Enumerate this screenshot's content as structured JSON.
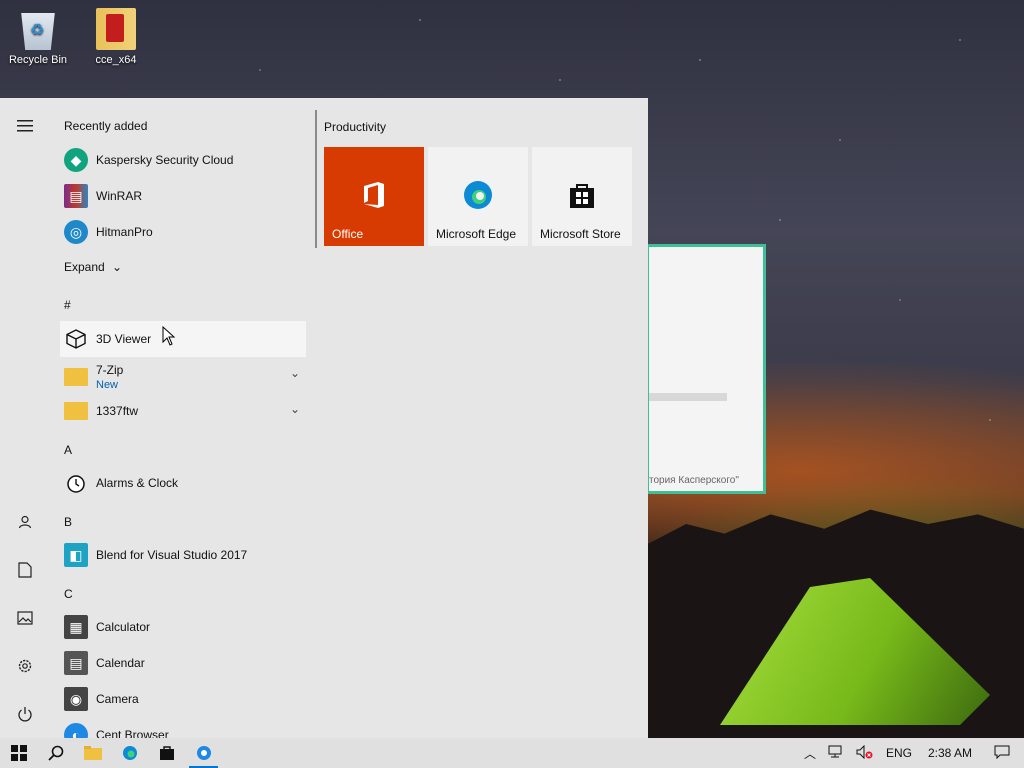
{
  "desktop": {
    "icons": [
      {
        "label": "Recycle Bin"
      },
      {
        "label": "cce_x64"
      }
    ],
    "background_window": {
      "text": "тория Касперского\""
    }
  },
  "start_menu": {
    "recently_added_label": "Recently added",
    "recent_apps": [
      {
        "name": "Kaspersky Security Cloud",
        "icon": "kaspersky-icon",
        "color": "#10a37f"
      },
      {
        "name": "WinRAR",
        "icon": "winrar-icon",
        "color": "#7b2c8c"
      },
      {
        "name": "HitmanPro",
        "icon": "hitmanpro-icon",
        "color": "#1e88c9"
      }
    ],
    "expand_label": "Expand",
    "sections": {
      "hash": "#",
      "a": "A",
      "b": "B",
      "c": "C"
    },
    "apps": {
      "viewer3d": {
        "name": "3D Viewer"
      },
      "zip7": {
        "name": "7-Zip",
        "sub": "New"
      },
      "ftw": {
        "name": "1337ftw"
      },
      "alarms": {
        "name": "Alarms & Clock"
      },
      "blend": {
        "name": "Blend for Visual Studio 2017"
      },
      "calculator": {
        "name": "Calculator"
      },
      "calendar": {
        "name": "Calendar"
      },
      "camera": {
        "name": "Camera"
      },
      "cent": {
        "name": "Cent Browser"
      }
    },
    "group_title": "Productivity",
    "tiles": [
      {
        "label": "Office",
        "bg": "#d83b01",
        "fg": "#ffffff"
      },
      {
        "label": "Microsoft Edge",
        "bg": "#f2f2f2",
        "fg": "#111111"
      },
      {
        "label": "Microsoft Store",
        "bg": "#f2f2f2",
        "fg": "#111111"
      }
    ]
  },
  "taskbar": {
    "language": "ENG",
    "time": "2:38 AM"
  }
}
